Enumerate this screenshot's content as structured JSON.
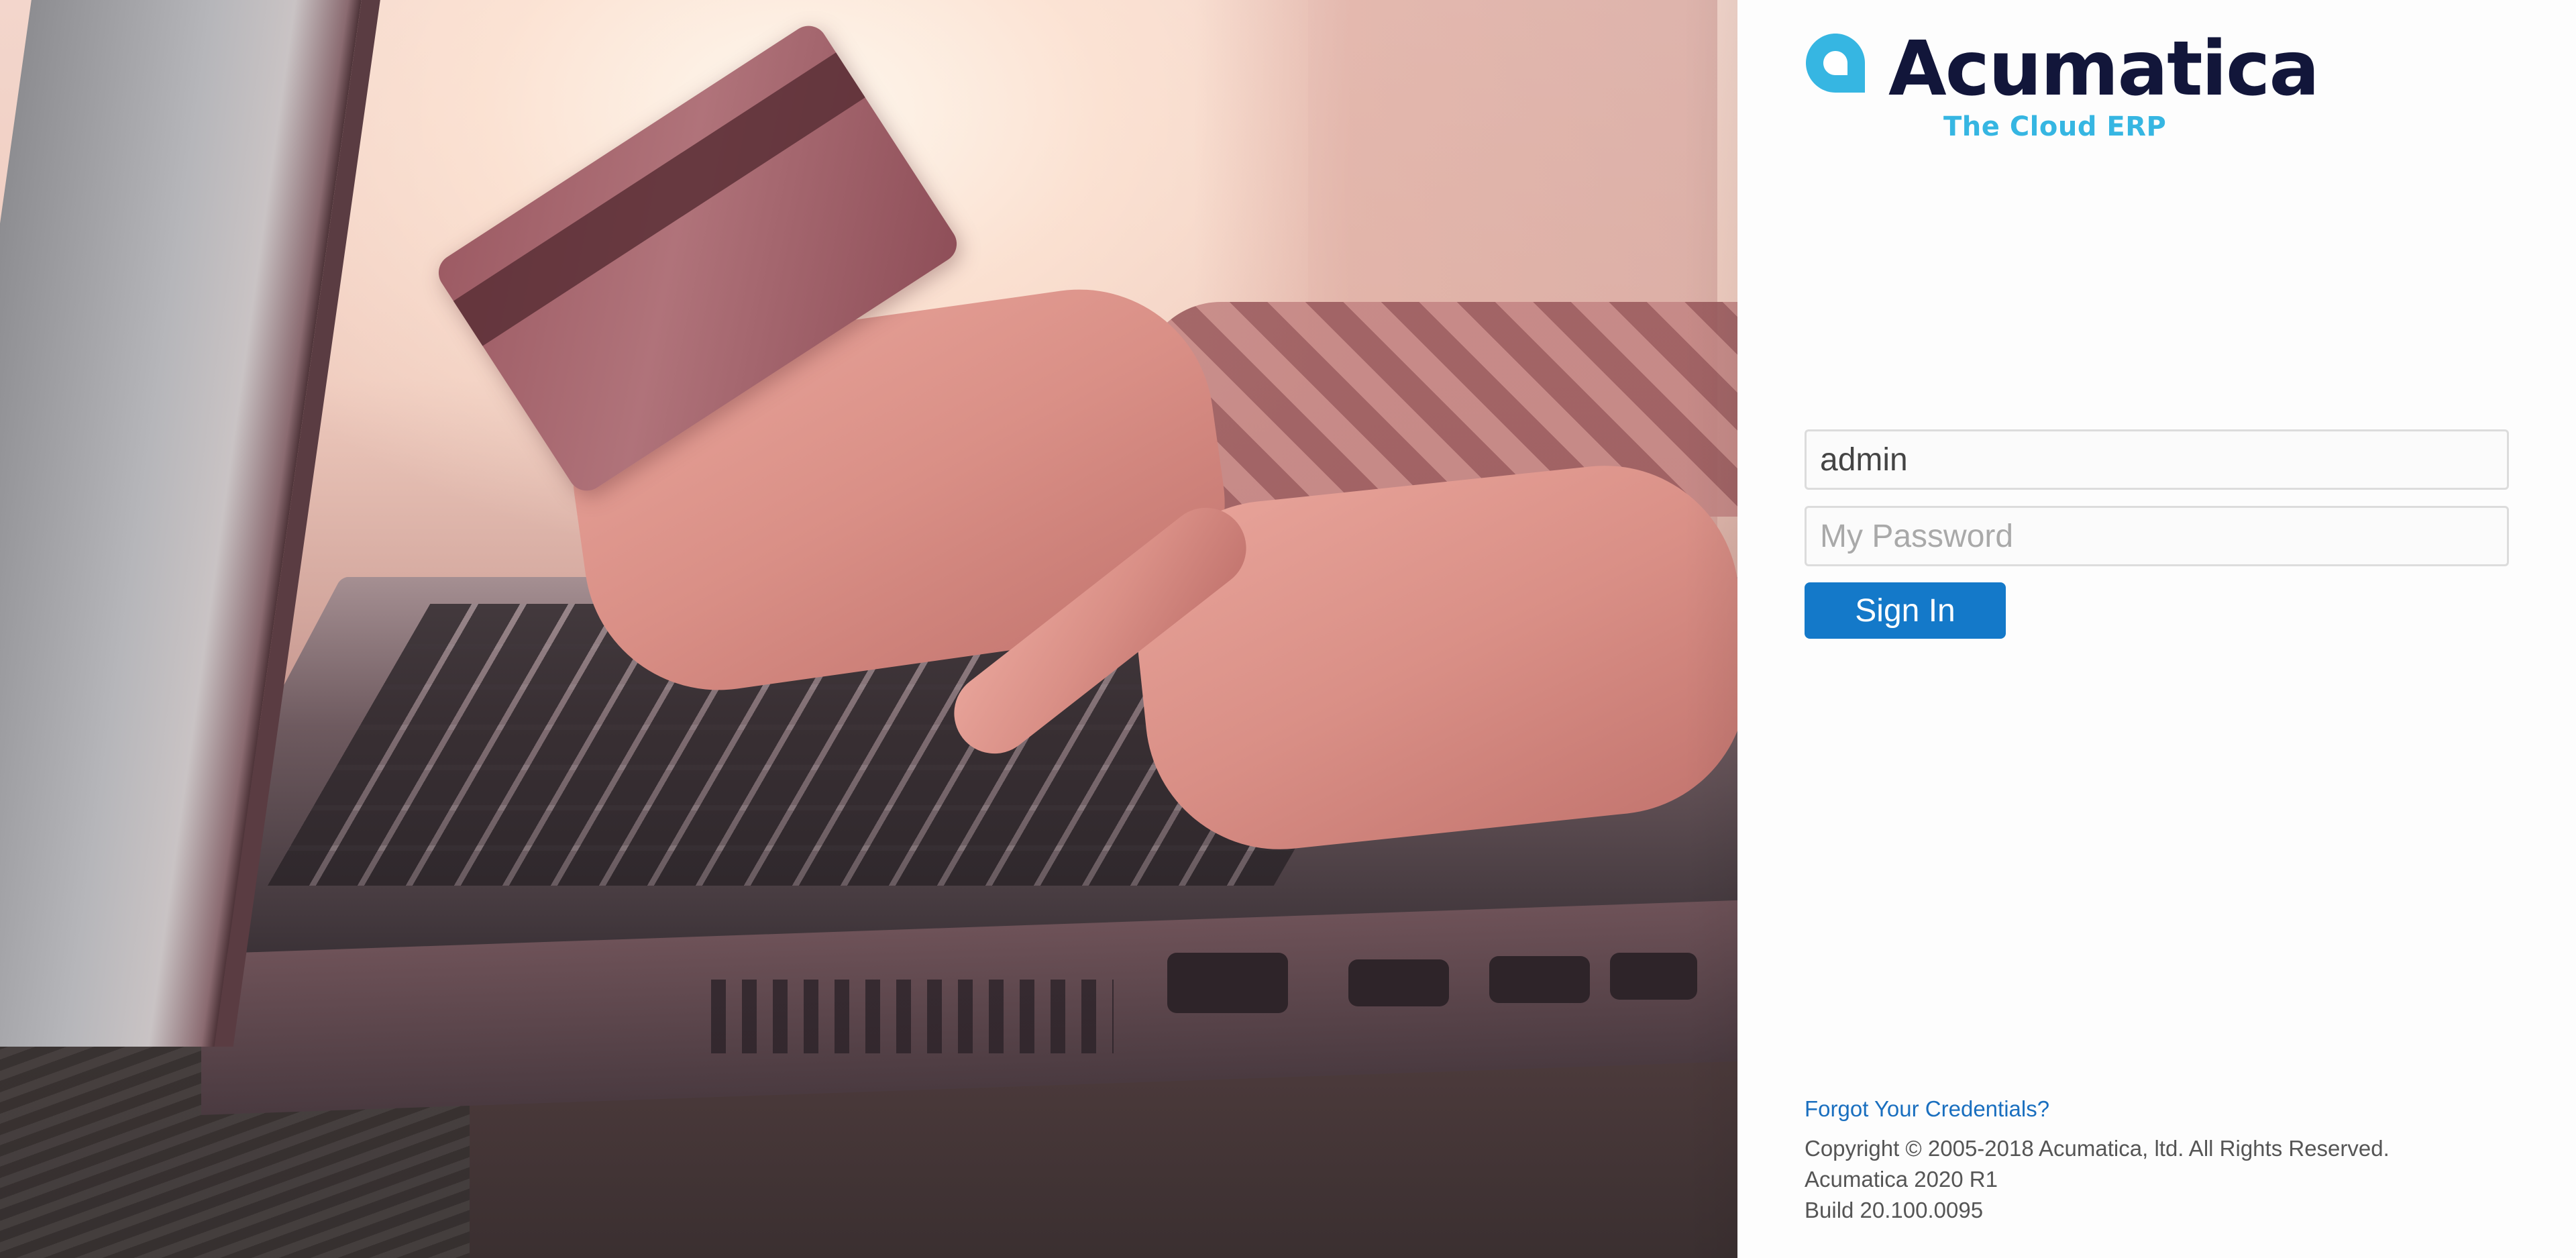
{
  "hero": {
    "image": "laptop-credit-card-photo"
  },
  "brand": {
    "name": "Acumatica",
    "tagline": "The Cloud ERP",
    "logo_icon": "acumatica-logo-icon",
    "colors": {
      "wordmark": "#12163a",
      "accent": "#36b6e2"
    }
  },
  "login": {
    "username_value": "admin",
    "password_placeholder": "My Password",
    "signin_label": "Sign In",
    "signin_color": "#1479c9"
  },
  "footer": {
    "forgot_link": "Forgot Your Credentials?",
    "copyright": "Copyright © 2005-2018 Acumatica, ltd. All Rights Reserved.",
    "version": "Acumatica 2020 R1",
    "build": "Build 20.100.0095"
  }
}
